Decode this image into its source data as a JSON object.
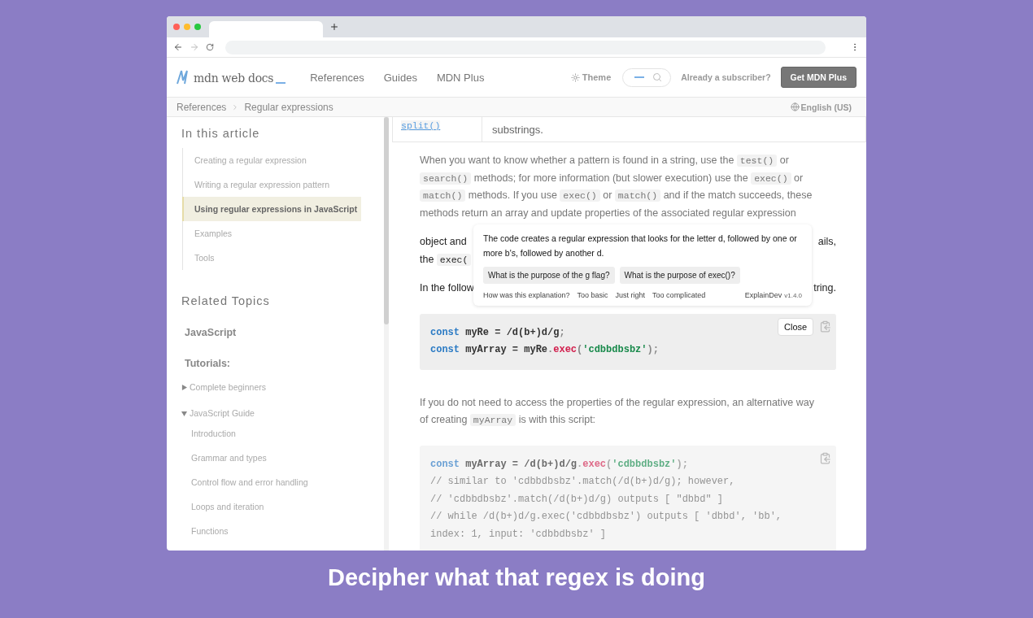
{
  "header": {
    "logo": "mdn web docs",
    "nav": [
      "References",
      "Guides",
      "MDN Plus"
    ],
    "theme": "Theme",
    "subscriber_link": "Already a subscriber?",
    "cta": "Get MDN Plus"
  },
  "breadcrumbs": [
    "References",
    "Regular expressions"
  ],
  "language": "English (US)",
  "sidebar": {
    "toc_title": "In this article",
    "toc": [
      {
        "label": "Creating a regular expression",
        "selected": false
      },
      {
        "label": "Writing a regular expression pattern",
        "selected": false
      },
      {
        "label": "Using regular expressions in JavaScript",
        "selected": true
      },
      {
        "label": "Examples",
        "selected": false
      },
      {
        "label": "Tools",
        "selected": false
      }
    ],
    "related_title": "Related Topics",
    "section": "JavaScript",
    "tutorials_title": "Tutorials:",
    "tutorials": [
      {
        "label": "Complete beginners",
        "expanded": false
      },
      {
        "label": "JavaScript Guide",
        "expanded": true,
        "children": [
          {
            "label": "Introduction"
          },
          {
            "label": "Grammar and types"
          },
          {
            "label": "Control flow and error handling"
          },
          {
            "label": "Loops and iteration"
          },
          {
            "label": "Functions"
          }
        ]
      }
    ]
  },
  "content": {
    "table_row": {
      "method": "split()",
      "description": "substrings."
    },
    "blocks": [
      {
        "kind": "paragraph",
        "dimmed": true,
        "lines": [
          [
            {
              "kind": "text",
              "text": "When you want to know whether a pattern is found in a string, use the "
            },
            {
              "kind": "code",
              "text": "test()"
            },
            {
              "kind": "text",
              "text": " or"
            }
          ],
          [
            {
              "kind": "code",
              "text": "search()"
            },
            {
              "kind": "text",
              "text": " methods; for more information (but slower execution) use the "
            },
            {
              "kind": "code",
              "text": "exec()"
            },
            {
              "kind": "text",
              "text": " or"
            }
          ],
          [
            {
              "kind": "code",
              "text": "match()"
            },
            {
              "kind": "text",
              "text": " methods. If you use "
            },
            {
              "kind": "code",
              "text": "exec()"
            },
            {
              "kind": "text",
              "text": " or "
            },
            {
              "kind": "code",
              "text": "match()"
            },
            {
              "kind": "text",
              "text": " and if the match succeeds, these"
            }
          ],
          [
            {
              "kind": "text",
              "text": "methods return an array and update properties of the associated regular expression"
            }
          ]
        ]
      },
      {
        "kind": "covered",
        "dimmed": false,
        "rows": [
          {
            "left": [
              {
                "kind": "text",
                "text": "object and"
              }
            ],
            "right": [
              {
                "kind": "text",
                "text": "ails,"
              }
            ]
          },
          {
            "left": [
              {
                "kind": "text",
                "text": "the "
              },
              {
                "kind": "code",
                "text": "exec("
              }
            ],
            "right": []
          }
        ]
      },
      {
        "kind": "covered",
        "dimmed": false,
        "rows": [
          {
            "left": [
              {
                "kind": "text",
                "text": "In the follow"
              }
            ],
            "right": [
              {
                "kind": "text",
                "text": "tring."
              }
            ]
          }
        ]
      },
      {
        "kind": "code",
        "dimmed": false,
        "lines": [
          [
            {
              "kind": "keyword",
              "text": "const"
            },
            {
              "kind": "plain",
              "text": " myRe = /d(b+)d/g"
            },
            {
              "kind": "punct",
              "text": ";"
            }
          ],
          [
            {
              "kind": "keyword",
              "text": "const"
            },
            {
              "kind": "plain",
              "text": " myArray = myRe"
            },
            {
              "kind": "punct",
              "text": "."
            },
            {
              "kind": "method",
              "text": "exec"
            },
            {
              "kind": "punct",
              "text": "("
            },
            {
              "kind": "string",
              "text": "'cdbbdbsbz'"
            },
            {
              "kind": "punct",
              "text": ");"
            }
          ]
        ]
      },
      {
        "kind": "paragraph",
        "dimmed": true,
        "lines": [
          [
            {
              "kind": "text",
              "text": "If you do not need to access the properties of the regular expression, an alternative way"
            }
          ],
          [
            {
              "kind": "text",
              "text": "of creating "
            },
            {
              "kind": "code",
              "text": "myArray"
            },
            {
              "kind": "text",
              "text": " is with this script:"
            }
          ]
        ]
      },
      {
        "kind": "code",
        "dimmed": true,
        "lines": [
          [
            {
              "kind": "keyword",
              "text": "const"
            },
            {
              "kind": "plain",
              "text": " myArray = /d(b+)d/g"
            },
            {
              "kind": "punct",
              "text": "."
            },
            {
              "kind": "method",
              "text": "exec"
            },
            {
              "kind": "punct",
              "text": "("
            },
            {
              "kind": "string",
              "text": "'cdbbdbsbz'"
            },
            {
              "kind": "punct",
              "text": ");"
            }
          ],
          [
            {
              "kind": "comment",
              "text": "// similar to 'cdbbdbsbz'.match(/d(b+)d/g); however,"
            }
          ],
          [
            {
              "kind": "comment",
              "text": "// 'cdbbdbsbz'.match(/d(b+)d/g) outputs [ \"dbbd\" ]"
            }
          ],
          [
            {
              "kind": "comment",
              "text": "// while /d(b+)d/g.exec('cdbbdbsbz') outputs [ 'dbbd', 'bb',"
            }
          ],
          [
            {
              "kind": "comment",
              "text": "index: 1, input: 'cdbbdbsbz' ]"
            }
          ]
        ]
      }
    ]
  },
  "popup": {
    "explanation": "The code creates a regular expression that looks for the letter d, followed by one or more b's, followed by another d.",
    "suggestions": [
      "What is the purpose of the g flag?",
      "What is the purpose of exec()?"
    ],
    "feedback_prompt": "How was this explanation?",
    "feedback_options": [
      "Too basic",
      "Just right",
      "Too complicated"
    ],
    "brand": "ExplainDev",
    "version": "v1.4.0",
    "close": "Close"
  },
  "caption": "Decipher what that regex is doing"
}
